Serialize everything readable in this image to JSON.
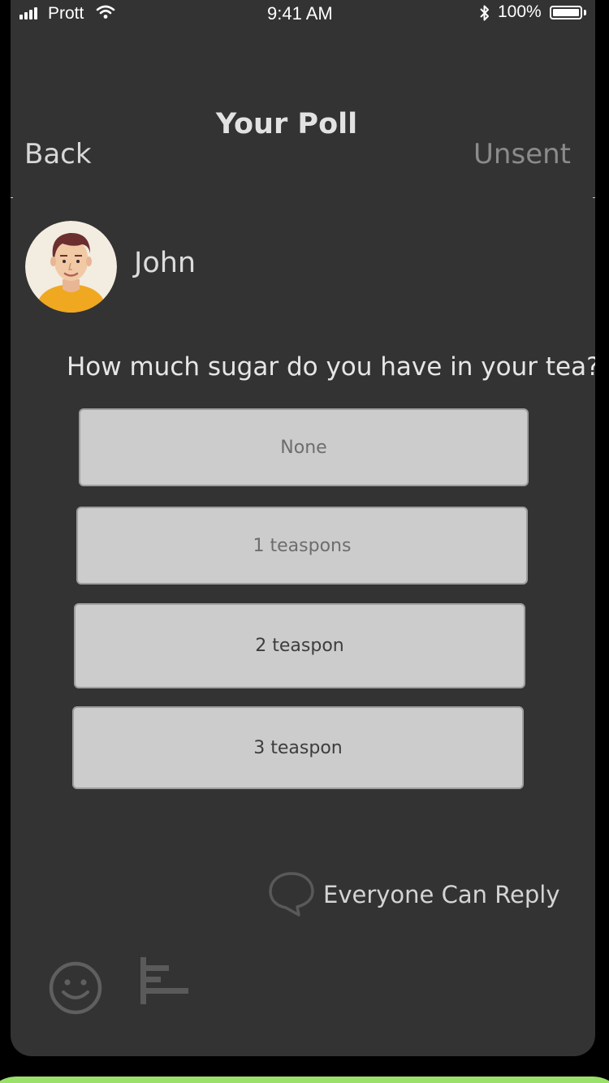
{
  "status_bar": {
    "carrier": "Prott",
    "time": "9:41 AM",
    "battery": "100%",
    "icons": [
      "signal-icon",
      "wifi-icon",
      "bluetooth-icon",
      "battery-icon"
    ]
  },
  "nav": {
    "title": "Your Poll",
    "back_label": "Back",
    "right_label": "Unsent"
  },
  "author": {
    "name": "John",
    "avatar_icon": "person-avatar"
  },
  "poll": {
    "question": "How much sugar do you have in your tea?",
    "options": [
      {
        "label": "None"
      },
      {
        "label": "1 teaspons"
      },
      {
        "label": "2 teaspon"
      },
      {
        "label": "3 teaspon"
      }
    ]
  },
  "reply": {
    "label": "Everyone Can Reply",
    "icon": "speech-bubble-icon"
  },
  "toolbar": {
    "icons": [
      "smiley-icon",
      "bar-chart-icon"
    ]
  },
  "colors": {
    "background": "#333333",
    "option_fill": "#cccccc",
    "option_border": "#9e9e9e",
    "muted_text": "#8b8b8b",
    "avatar_shirt": "#f0a820",
    "avatar_hair": "#6b2f2f"
  }
}
